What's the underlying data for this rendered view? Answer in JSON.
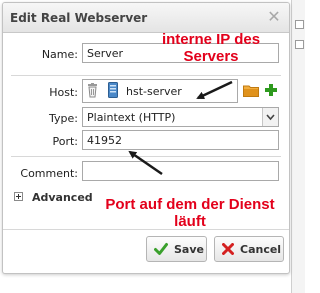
{
  "dialog": {
    "title": "Edit Real Webserver",
    "close_icon": "close-icon"
  },
  "form": {
    "name_label": "Name:",
    "name_value": "Server",
    "host_label": "Host:",
    "host_value": "hst-server",
    "host_icons": [
      "trash-icon",
      "server-icon",
      "folder-icon",
      "add-icon"
    ],
    "type_label": "Type:",
    "type_value": "Plaintext (HTTP)",
    "port_label": "Port:",
    "port_value": "41952",
    "comment_label": "Comment:",
    "comment_value": "",
    "advanced_label": "Advanced"
  },
  "buttons": {
    "save_label": "Save",
    "cancel_label": "Cancel"
  },
  "annotations": {
    "host_note": "interne IP des Servers",
    "port_note": "Port auf dem der Dienst läuft"
  },
  "colors": {
    "annotation": "#e3001b",
    "save_check": "#3aa02c",
    "cancel_x": "#d42020",
    "add_plus": "#2e9a1e",
    "folder": "#e0921c"
  }
}
